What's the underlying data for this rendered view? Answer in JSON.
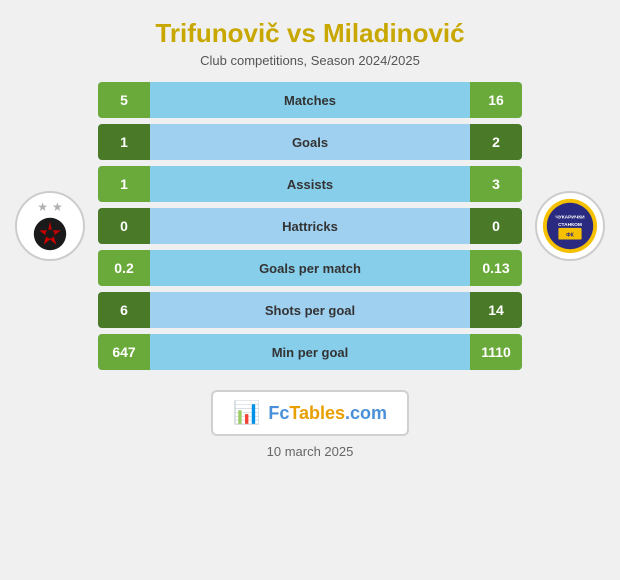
{
  "header": {
    "title": "Trifunovič vs Miladinović",
    "subtitle": "Club competitions, Season 2024/2025"
  },
  "stats": [
    {
      "id": "matches",
      "label": "Matches",
      "left": "5",
      "right": "16",
      "dark": false
    },
    {
      "id": "goals",
      "label": "Goals",
      "left": "1",
      "right": "2",
      "dark": true
    },
    {
      "id": "assists",
      "label": "Assists",
      "left": "1",
      "right": "3",
      "dark": false
    },
    {
      "id": "hattricks",
      "label": "Hattricks",
      "left": "0",
      "right": "0",
      "dark": true
    },
    {
      "id": "goals-per-match",
      "label": "Goals per match",
      "left": "0.2",
      "right": "0.13",
      "dark": false
    },
    {
      "id": "shots-per-goal",
      "label": "Shots per goal",
      "left": "6",
      "right": "14",
      "dark": true
    },
    {
      "id": "min-per-goal",
      "label": "Min per goal",
      "left": "647",
      "right": "1110",
      "dark": false
    }
  ],
  "fctables": {
    "label": "FcTables.com"
  },
  "footer": {
    "date": "10 march 2025"
  }
}
